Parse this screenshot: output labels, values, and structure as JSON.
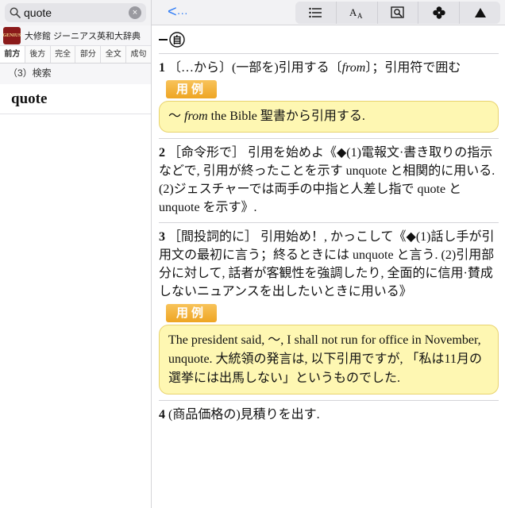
{
  "search": {
    "query": "quote",
    "clear_glyph": "×"
  },
  "dictionary": {
    "logo_text": "GENIUS",
    "name": "大修館 ジーニアス英和大辞典"
  },
  "search_modes": [
    "前方",
    "後方",
    "完全",
    "部分",
    "全文",
    "成句"
  ],
  "sub_label": "（3）検索",
  "results": [
    "quote"
  ],
  "toolbar": {
    "back_glyph": "<",
    "back_suffix": "···",
    "buttons": [
      {
        "icon": "list-icon",
        "glyph": "☰"
      },
      {
        "icon": "text-size-icon",
        "glyph": "AA"
      },
      {
        "icon": "dictionary-search-icon",
        "glyph": "▣"
      },
      {
        "icon": "clover-icon",
        "glyph": "✤"
      },
      {
        "icon": "triangle-up-icon",
        "glyph": "▲"
      }
    ]
  },
  "entry": {
    "pos_label": "自",
    "senses": [
      {
        "num": "1",
        "text_before": " 〔…から〕(一部を)引用する〔",
        "italic": "from",
        "text_after": "〕；引用符で囲む",
        "example_badge": "用例",
        "example": {
          "prefix": "～ ",
          "italic": "from",
          "rest": " the Bible 聖書から引用する."
        }
      },
      {
        "num": "2",
        "text": " ［命令形で］ 引用を始めよ《◆(1)電報文·書き取りの指示などで, 引用が終ったことを示す unquote と相関的に用いる. (2)ジェスチャーでは両手の中指と人差し指で quote と unquote を示す》."
      },
      {
        "num": "3",
        "text": " ［間投詞的に］ 引用始め！, かっこして《◆(1)話し手が引用文の最初に言う；終るときには unquote と言う. (2)引用部分に対して, 話者が客観性を強調したり, 全面的に信用·賛成しないニュアンスを出したいときに用いる》",
        "example_badge": "用例",
        "example_text": "The president said, ～, I shall not run for office in November, unquote. 大統領の発言は, 以下引用ですが, 「私は11月の選挙には出馬しない」というものでした."
      },
      {
        "num": "4",
        "text": " (商品価格の)見積りを出す."
      }
    ]
  }
}
